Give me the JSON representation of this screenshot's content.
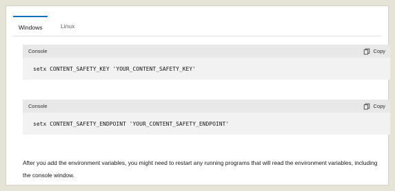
{
  "tabs": [
    {
      "label": "Windows",
      "active": true
    },
    {
      "label": "Linux",
      "active": false
    }
  ],
  "code_blocks": [
    {
      "title": "Console",
      "copy_label": "Copy",
      "code": "setx CONTENT_SAFETY_KEY 'YOUR_CONTENT_SAFETY_KEY'"
    },
    {
      "title": "Console",
      "copy_label": "Copy",
      "code": "setx CONTENT_SAFETY_ENDPOINT 'YOUR_CONTENT_SAFETY_ENDPOINT'"
    }
  ],
  "note": "After you add the environment variables, you might need to restart any running programs that will read the environment variables, including the console window.",
  "colors": {
    "accent": "#0f6cbd",
    "code_header_bg": "#e8e8e8",
    "code_body_bg": "#f2f2f2",
    "page_bg": "#e6e3d7"
  },
  "icons": {
    "copy": "copy-icon"
  }
}
